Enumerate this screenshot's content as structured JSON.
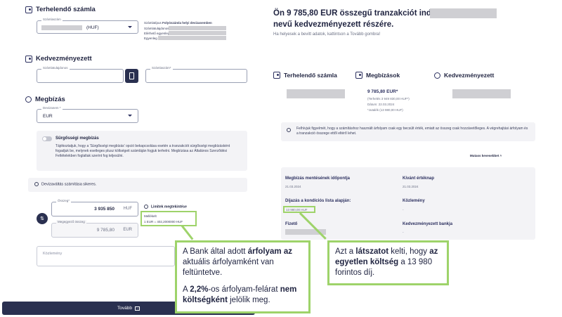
{
  "left": {
    "source_section": {
      "title": "Terhelendő számla",
      "account_field": {
        "label": "Számlaszám",
        "currency": "(HUF)"
      },
      "info": {
        "type_label": "Számlatípus",
        "type_value": "Folyószámla helyi devizanemben",
        "number_label": "Számlatulajdonos",
        "disposable_label": "Elérhető egyenleg",
        "balance_label": "Egyenleg"
      }
    },
    "beneficiary_section": {
      "title": "Kedvezményezett",
      "name_label": "Számlatulajdonos",
      "account_label": "Számlaszám*"
    },
    "order_section": {
      "title": "Megbízás",
      "currency_label": "Devizanem *",
      "currency_value": "EUR",
      "urgent_title": "Sürgősségi megbízás",
      "urgent_text": "Tájékoztatjuk, hogy a 'Sürgősségi megbízás' opció bekapcsolása esetén a tranzakciót sürgősségi megbízásként fogadjuk be, melynek esetleges plusz költségeit számláján fogjuk terhelni. Megbízása az Általános Szerződési Feltételekben foglaltak szerint fog teljesülni.",
      "conversion_success": "Devizaváltás számítása sikeres.",
      "amount_label": "Összeg*",
      "amount_value": "3 935 850",
      "amount_currency": "HUF",
      "converted_label": "Megegyező összeg",
      "converted_value": "9 785,80",
      "converted_currency": "EUR",
      "limits_link": "Limitek megtekintése",
      "rate_title": "Mellékelt",
      "rate_text": "1 EUR = 402,2000000 HUF",
      "comment_placeholder": "Közlemény"
    },
    "next_button": "Tovább"
  },
  "right": {
    "headline_1": "Ön 9 785,80 EUR összegű tranzakciót indít",
    "headline_2": "nevű kedvezményezett részére.",
    "subline": "Ha helyesek a bevitt adatok, kattintson a Tovább gombra!",
    "col_source": "Terhelendő számla",
    "col_orders": "Megbízások",
    "col_beneficiary": "Kedvezményezett",
    "order_amount": "9 785,80 EUR*",
    "order_line_1": "(Terhelés 3 949 830,00 HUF*)",
    "order_line_2": "Dátum: 22.03.2024",
    "order_line_3": "*Jutalék (13 980,00 HUF)",
    "notice": "Felhívjuk figyelmét, hogy a számításhoz használt árfolyam csak egy becsült érték, emiatt az összeg csak hozzávetőleges. A végrehajtási árfolyam és a tranzakció összege ettől eltérő lehet.",
    "show_less": "Mutass kevesebbet",
    "details": {
      "created_label": "Megbízás mentésének időpontja",
      "created_value": "21.03.2024",
      "value_date_label": "Kívánt értéknap",
      "value_date_value": "21.03.2024",
      "fee_label": "Díjazás a kondíciós lista alapján:",
      "fee_value": "13 980,00 HUF",
      "remark_label": "Közlemény",
      "remark_value": "-",
      "payer_label": "Fizető",
      "bank_label": "Kedvezményezett bankja",
      "bank_value": "-"
    }
  },
  "callouts": {
    "left_p1_a": "A Bank által adott ",
    "left_p1_b": "árfolyam az",
    "left_p1_c": " aktuális árfolyamként van feltüntetve.",
    "left_p2_a": "A ",
    "left_p2_b": "2,2%",
    "left_p2_c": "-os árfolyam-felárat ",
    "left_p2_d": "nem költségként",
    "left_p2_e": " jelölik meg.",
    "right_a": "Azt a ",
    "right_b": "látszatot",
    "right_c": " kelti, hogy ",
    "right_d": "az egyetlen költség",
    "right_e": " a 13 980 forintos díj."
  },
  "colors": {
    "accent": "#9ed36a",
    "navy": "#2a3050"
  }
}
